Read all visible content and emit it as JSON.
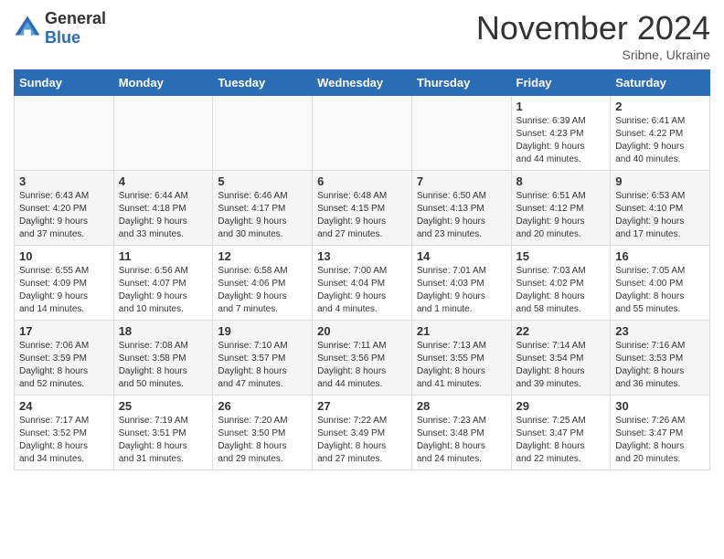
{
  "logo": {
    "general": "General",
    "blue": "Blue"
  },
  "title": "November 2024",
  "subtitle": "Sribne, Ukraine",
  "headers": [
    "Sunday",
    "Monday",
    "Tuesday",
    "Wednesday",
    "Thursday",
    "Friday",
    "Saturday"
  ],
  "weeks": [
    [
      {
        "day": "",
        "info": ""
      },
      {
        "day": "",
        "info": ""
      },
      {
        "day": "",
        "info": ""
      },
      {
        "day": "",
        "info": ""
      },
      {
        "day": "",
        "info": ""
      },
      {
        "day": "1",
        "info": "Sunrise: 6:39 AM\nSunset: 4:23 PM\nDaylight: 9 hours\nand 44 minutes."
      },
      {
        "day": "2",
        "info": "Sunrise: 6:41 AM\nSunset: 4:22 PM\nDaylight: 9 hours\nand 40 minutes."
      }
    ],
    [
      {
        "day": "3",
        "info": "Sunrise: 6:43 AM\nSunset: 4:20 PM\nDaylight: 9 hours\nand 37 minutes."
      },
      {
        "day": "4",
        "info": "Sunrise: 6:44 AM\nSunset: 4:18 PM\nDaylight: 9 hours\nand 33 minutes."
      },
      {
        "day": "5",
        "info": "Sunrise: 6:46 AM\nSunset: 4:17 PM\nDaylight: 9 hours\nand 30 minutes."
      },
      {
        "day": "6",
        "info": "Sunrise: 6:48 AM\nSunset: 4:15 PM\nDaylight: 9 hours\nand 27 minutes."
      },
      {
        "day": "7",
        "info": "Sunrise: 6:50 AM\nSunset: 4:13 PM\nDaylight: 9 hours\nand 23 minutes."
      },
      {
        "day": "8",
        "info": "Sunrise: 6:51 AM\nSunset: 4:12 PM\nDaylight: 9 hours\nand 20 minutes."
      },
      {
        "day": "9",
        "info": "Sunrise: 6:53 AM\nSunset: 4:10 PM\nDaylight: 9 hours\nand 17 minutes."
      }
    ],
    [
      {
        "day": "10",
        "info": "Sunrise: 6:55 AM\nSunset: 4:09 PM\nDaylight: 9 hours\nand 14 minutes."
      },
      {
        "day": "11",
        "info": "Sunrise: 6:56 AM\nSunset: 4:07 PM\nDaylight: 9 hours\nand 10 minutes."
      },
      {
        "day": "12",
        "info": "Sunrise: 6:58 AM\nSunset: 4:06 PM\nDaylight: 9 hours\nand 7 minutes."
      },
      {
        "day": "13",
        "info": "Sunrise: 7:00 AM\nSunset: 4:04 PM\nDaylight: 9 hours\nand 4 minutes."
      },
      {
        "day": "14",
        "info": "Sunrise: 7:01 AM\nSunset: 4:03 PM\nDaylight: 9 hours\nand 1 minute."
      },
      {
        "day": "15",
        "info": "Sunrise: 7:03 AM\nSunset: 4:02 PM\nDaylight: 8 hours\nand 58 minutes."
      },
      {
        "day": "16",
        "info": "Sunrise: 7:05 AM\nSunset: 4:00 PM\nDaylight: 8 hours\nand 55 minutes."
      }
    ],
    [
      {
        "day": "17",
        "info": "Sunrise: 7:06 AM\nSunset: 3:59 PM\nDaylight: 8 hours\nand 52 minutes."
      },
      {
        "day": "18",
        "info": "Sunrise: 7:08 AM\nSunset: 3:58 PM\nDaylight: 8 hours\nand 50 minutes."
      },
      {
        "day": "19",
        "info": "Sunrise: 7:10 AM\nSunset: 3:57 PM\nDaylight: 8 hours\nand 47 minutes."
      },
      {
        "day": "20",
        "info": "Sunrise: 7:11 AM\nSunset: 3:56 PM\nDaylight: 8 hours\nand 44 minutes."
      },
      {
        "day": "21",
        "info": "Sunrise: 7:13 AM\nSunset: 3:55 PM\nDaylight: 8 hours\nand 41 minutes."
      },
      {
        "day": "22",
        "info": "Sunrise: 7:14 AM\nSunset: 3:54 PM\nDaylight: 8 hours\nand 39 minutes."
      },
      {
        "day": "23",
        "info": "Sunrise: 7:16 AM\nSunset: 3:53 PM\nDaylight: 8 hours\nand 36 minutes."
      }
    ],
    [
      {
        "day": "24",
        "info": "Sunrise: 7:17 AM\nSunset: 3:52 PM\nDaylight: 8 hours\nand 34 minutes."
      },
      {
        "day": "25",
        "info": "Sunrise: 7:19 AM\nSunset: 3:51 PM\nDaylight: 8 hours\nand 31 minutes."
      },
      {
        "day": "26",
        "info": "Sunrise: 7:20 AM\nSunset: 3:50 PM\nDaylight: 8 hours\nand 29 minutes."
      },
      {
        "day": "27",
        "info": "Sunrise: 7:22 AM\nSunset: 3:49 PM\nDaylight: 8 hours\nand 27 minutes."
      },
      {
        "day": "28",
        "info": "Sunrise: 7:23 AM\nSunset: 3:48 PM\nDaylight: 8 hours\nand 24 minutes."
      },
      {
        "day": "29",
        "info": "Sunrise: 7:25 AM\nSunset: 3:47 PM\nDaylight: 8 hours\nand 22 minutes."
      },
      {
        "day": "30",
        "info": "Sunrise: 7:26 AM\nSunset: 3:47 PM\nDaylight: 8 hours\nand 20 minutes."
      }
    ]
  ]
}
